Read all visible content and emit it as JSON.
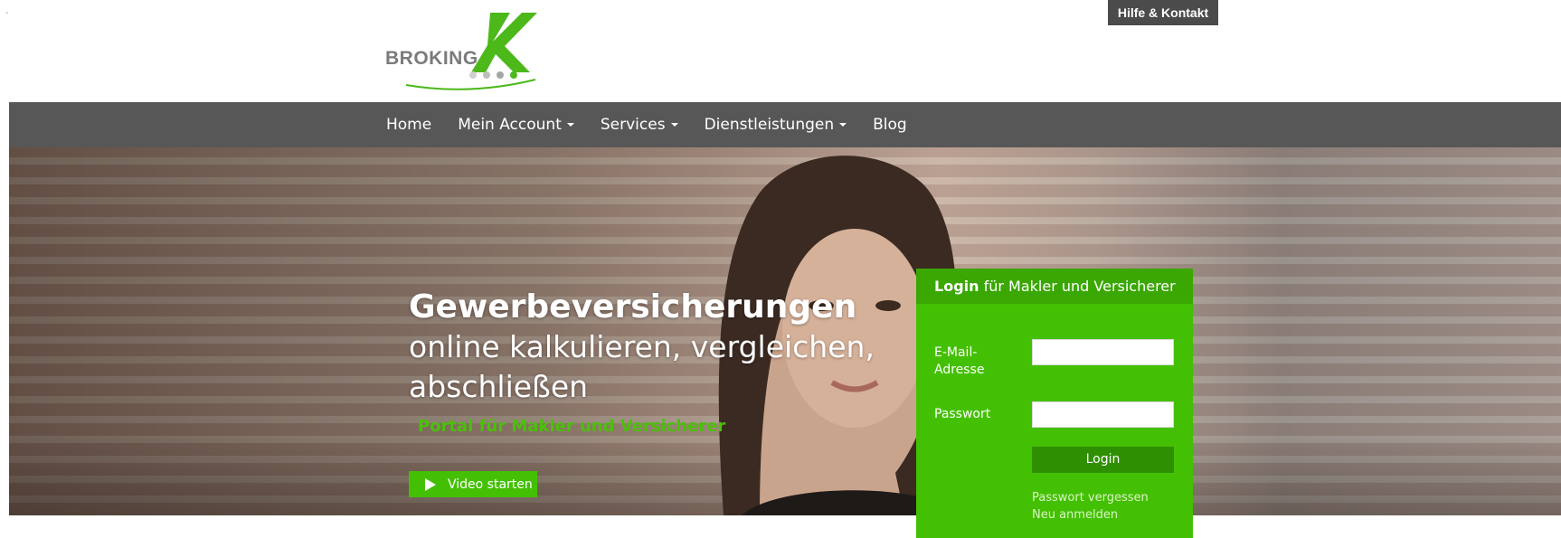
{
  "header": {
    "stray_mark": "-",
    "logo": {
      "word": "BROKING",
      "mark": "X",
      "icon": "brokingx-logo"
    },
    "help_link": "Hilfe & Kontakt"
  },
  "nav": {
    "items": [
      {
        "label": "Home",
        "has_dropdown": false
      },
      {
        "label": "Mein Account",
        "has_dropdown": true
      },
      {
        "label": "Services",
        "has_dropdown": true
      },
      {
        "label": "Dienstleistungen",
        "has_dropdown": true
      },
      {
        "label": "Blog",
        "has_dropdown": false
      }
    ]
  },
  "hero": {
    "headline_bold": "Gewerbeversicherungen",
    "headline_light": "online kalkulieren, vergleichen, abschließen",
    "tagline": "Portal für Makler und Versicherer",
    "video_button": "Video starten",
    "video_icon": "play-icon"
  },
  "login": {
    "title_bold": "Login",
    "title_rest": " für Makler und Versicherer",
    "email_label": "E-Mail-Adresse",
    "email_value": "",
    "password_label": "Passwort",
    "password_value": "",
    "submit_label": "Login",
    "forgot_link": "Passwort vergessen",
    "register_link": "Neu anmelden"
  },
  "colors": {
    "brand_green": "#44c004",
    "header_green": "#3aa703",
    "nav_gray": "#575757",
    "logo_gray": "#7b7b7b"
  }
}
